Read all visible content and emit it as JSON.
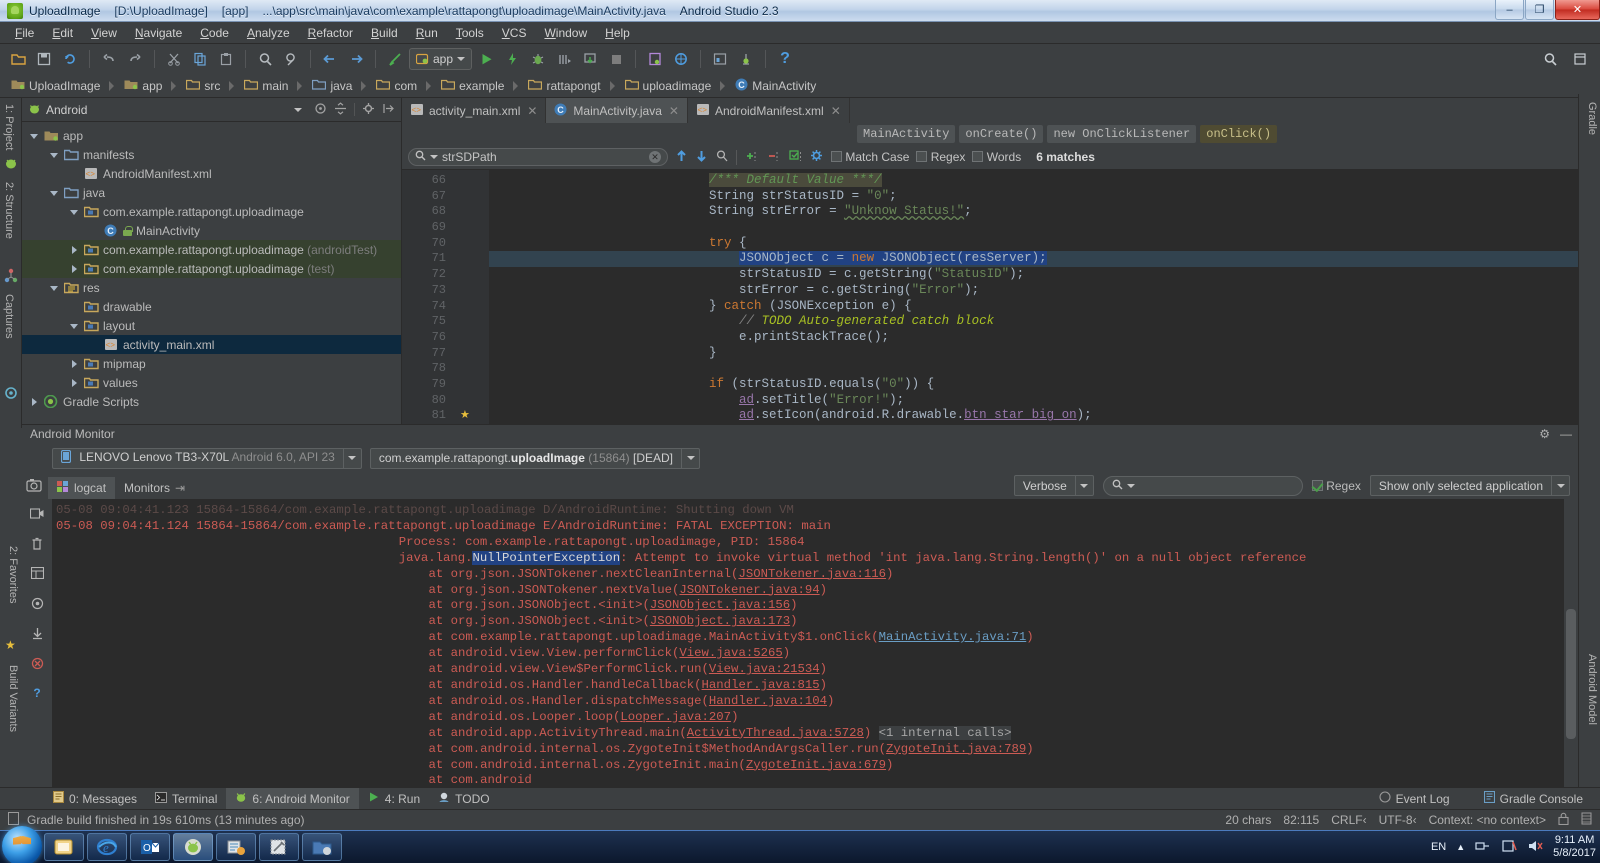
{
  "window": {
    "project_name": "UploadImage",
    "project_path": "[D:\\UploadImage]",
    "module": "[app]",
    "file_path": "...\\app\\src\\main\\java\\com\\example\\rattapongt\\uploadimage\\MainActivity.java",
    "ide": "Android Studio 2.3",
    "minimize": "–",
    "maximize": "❐",
    "close": "✕"
  },
  "menu": [
    "File",
    "Edit",
    "View",
    "Navigate",
    "Code",
    "Analyze",
    "Refactor",
    "Build",
    "Run",
    "Tools",
    "VCS",
    "Window",
    "Help"
  ],
  "toolbar": {
    "run_config": "app",
    "icons": [
      "open-folder-icon",
      "save-all-icon",
      "sync-icon",
      "undo-icon",
      "redo-icon",
      "cut-icon",
      "copy-icon",
      "paste-icon",
      "find-icon",
      "replace-icon",
      "back-icon",
      "forward-icon",
      "build-icon",
      "run-icon",
      "apply-changes-icon",
      "debug-icon",
      "run-coverage-icon",
      "attach-debugger-icon",
      "stop-icon",
      "sdk-manager-icon",
      "avd-manager-icon",
      "layout-inspector-icon",
      "device-monitor-icon",
      "help-icon"
    ],
    "right_icons": [
      "search-everywhere-icon",
      "stretch-icon"
    ]
  },
  "breadcrumb": [
    "UploadImage",
    "app",
    "src",
    "main",
    "java",
    "com",
    "example",
    "rattapongt",
    "uploadimage",
    "MainActivity"
  ],
  "project_panel": {
    "selector": "Android",
    "actions": [
      "target-icon",
      "collapse-icon",
      "settings-icon",
      "hide-icon"
    ],
    "tree": [
      {
        "depth": 0,
        "arrow": "down",
        "icon": "folder-module",
        "label": "app",
        "sel": false
      },
      {
        "depth": 1,
        "arrow": "down",
        "icon": "folder",
        "label": "manifests",
        "sel": false
      },
      {
        "depth": 2,
        "arrow": "none",
        "icon": "xml",
        "label": "AndroidManifest.xml",
        "sel": false
      },
      {
        "depth": 1,
        "arrow": "down",
        "icon": "folder",
        "label": "java",
        "sel": false
      },
      {
        "depth": 2,
        "arrow": "down",
        "icon": "folder-pkg",
        "label": "com.example.rattapongt.uploadimage",
        "sel": false
      },
      {
        "depth": 3,
        "arrow": "none",
        "icon": "class",
        "label": "MainActivity",
        "sel": false
      },
      {
        "depth": 2,
        "arrow": "right",
        "icon": "folder-pkg",
        "label": "com.example.rattapongt.uploadimage",
        "suffix": "(androidTest)",
        "test": true
      },
      {
        "depth": 2,
        "arrow": "right",
        "icon": "folder-pkg",
        "label": "com.example.rattapongt.uploadimage",
        "suffix": "(test)",
        "test": true
      },
      {
        "depth": 1,
        "arrow": "down",
        "icon": "folder-res",
        "label": "res",
        "sel": false
      },
      {
        "depth": 2,
        "arrow": "none",
        "icon": "folder-pkg",
        "label": "drawable",
        "sel": false
      },
      {
        "depth": 2,
        "arrow": "down",
        "icon": "folder-pkg",
        "label": "layout",
        "sel": false
      },
      {
        "depth": 3,
        "arrow": "none",
        "icon": "xml",
        "label": "activity_main.xml",
        "sel": true
      },
      {
        "depth": 2,
        "arrow": "right",
        "icon": "folder-pkg",
        "label": "mipmap",
        "sel": false
      },
      {
        "depth": 2,
        "arrow": "right",
        "icon": "folder-pkg",
        "label": "values",
        "sel": false
      },
      {
        "depth": 0,
        "arrow": "right",
        "icon": "gradle",
        "label": "Gradle Scripts",
        "sel": false
      }
    ]
  },
  "left_rail": [
    "1: Project",
    "2: Structure",
    "Captures"
  ],
  "right_rail": [
    "Gradle",
    "Android Model"
  ],
  "bottom_left_rail": [
    "2: Favorites",
    "Build Variants"
  ],
  "editor": {
    "tabs": [
      {
        "label": "activity_main.xml",
        "icon": "xml-icon",
        "active": false
      },
      {
        "label": "MainActivity.java",
        "icon": "class-icon",
        "active": true
      },
      {
        "label": "AndroidManifest.xml",
        "icon": "xml-icon",
        "active": false
      }
    ],
    "structure_crumbs": [
      {
        "label": "MainActivity",
        "hi": false
      },
      {
        "label": "onCreate()",
        "hi": false
      },
      {
        "label": "new OnClickListener",
        "hi": false
      },
      {
        "label": "onClick()",
        "hi": true
      }
    ],
    "find": {
      "query": "strSDPath",
      "match_case": "Match Case",
      "regex": "Regex",
      "words": "Words",
      "results": "6 matches",
      "close": "✕"
    },
    "first_line_number": 66,
    "lines": [
      {
        "n": 66,
        "html": "            <span class='cm' style='background:#4b4b3c'>/*** Default Value ***/</span>"
      },
      {
        "n": 67,
        "html": "            <span class='id'>String strStatusID</span> <span class='id'>=</span> <span class='str'>\"0\"</span><span class='id'>;</span>"
      },
      {
        "n": 68,
        "html": "            <span class='id'>String strError</span> <span class='id'>=</span> <span class='str wavy'>\"Unknow Status!\"</span><span class='id'>;</span>"
      },
      {
        "n": 69,
        "html": ""
      },
      {
        "n": 70,
        "html": "            <span class='kw'>try</span> <span class='id'>{</span>"
      },
      {
        "n": 71,
        "hl": true,
        "html": "                <span class='sel-hl'><span class='id'>JSONObject c = </span><span class='kw'>new</span><span class='id'> JSONObject(resServer);</span></span>"
      },
      {
        "n": 72,
        "html": "                <span class='id'>strStatusID = c.getString(</span><span class='str'>\"StatusID\"</span><span class='id'>);</span>"
      },
      {
        "n": 73,
        "html": "                <span class='id'>strError = c.getString(</span><span class='str'>\"Error\"</span><span class='id'>);</span>"
      },
      {
        "n": 74,
        "html": "            <span class='id'>}</span> <span class='kw'>catch</span> <span class='id'>(JSONException e) {</span>"
      },
      {
        "n": 75,
        "html": "                <span class='cm2'>// </span><span class='todo'>TODO Auto-generated catch block</span>"
      },
      {
        "n": 76,
        "html": "                <span class='id'>e.printStackTrace();</span>"
      },
      {
        "n": 77,
        "html": "            <span class='id'>}</span>"
      },
      {
        "n": 78,
        "html": ""
      },
      {
        "n": 79,
        "html": "            <span class='kw'>if</span> <span class='id'>(strStatusID.equals(</span><span class='str'>\"0\"</span><span class='id'>)) {</span>"
      },
      {
        "n": 80,
        "html": "                <span class='fieldref'>ad</span><span class='id'>.setTitle(</span><span class='str'>\"Error!\"</span><span class='id'>);</span>"
      },
      {
        "n": 81,
        "html": "                <span class='fieldref'>ad</span><span class='id'>.setIcon(android.R.drawable.</span><span class='fieldref'>btn_star_big_on</span><span class='id'>);</span>"
      }
    ]
  },
  "monitor": {
    "title": "Android Monitor",
    "device": {
      "name": "LENOVO Lenovo TB3-X70L",
      "detail": "Android 6.0, API 23"
    },
    "process": {
      "package_prefix": "com.example.rattapongt.",
      "package_bold": "uploadImage",
      "pid": "(15864)",
      "state": "[DEAD]"
    },
    "tabs": [
      {
        "label": "logcat",
        "active": true
      },
      {
        "label": "Monitors",
        "active": false
      }
    ],
    "log_level": "Verbose",
    "search_placeholder": "",
    "regex_label": "Regex",
    "scope": "Show only selected application",
    "rail_icons": [
      "camera-icon",
      "video-icon",
      "screenshot-icon",
      "layout-icon",
      "gc-icon",
      "dump-icon",
      "down-icon",
      "terminate-icon",
      "clear-icon",
      "scroll-end-icon",
      "up-icon",
      "down2-icon",
      "settings-icon",
      "help-icon"
    ],
    "log_lines": [
      {
        "cls": "dim",
        "text": "05-08 09:04:41.123 15864-15864/com.example.rattapongt.uploadimage D/AndroidRuntime: Shutting down VM"
      },
      {
        "html": "05-08 09:04:41.124 15864-15864/com.example.rattapongt.uploadimage E/AndroidRuntime: FATAL EXCEPTION: main"
      },
      {
        "indent": 46,
        "html": "Process: com.example.rattapongt.uploadimage, PID: 15864"
      },
      {
        "indent": 46,
        "html": "java.lang.<span class='selword'>NullPointerException</span>: Attempt to invoke virtual method 'int java.lang.String.length()' on a null object reference"
      },
      {
        "indent": 50,
        "html": "at org.json.JSONTokener.nextCleanInternal(<span class='lnk'>JSONTokener.java:116</span>)"
      },
      {
        "indent": 50,
        "html": "at org.json.JSONTokener.nextValue(<span class='lnk'>JSONTokener.java:94</span>)"
      },
      {
        "indent": 50,
        "html": "at org.json.JSONObject.&lt;init&gt;(<span class='lnk'>JSONObject.java:156</span>)"
      },
      {
        "indent": 50,
        "html": "at org.json.JSONObject.&lt;init&gt;(<span class='lnk'>JSONObject.java:173</span>)"
      },
      {
        "indent": 50,
        "html": "at com.example.rattapongt.uploadimage.MainActivity$1.onClick(<span class='lnkb'>MainActivity.java:71</span>)"
      },
      {
        "indent": 50,
        "html": "at android.view.View.performClick(<span class='lnk'>View.java:5265</span>)"
      },
      {
        "indent": 50,
        "html": "at android.view.View$PerformClick.run(<span class='lnk'>View.java:21534</span>)"
      },
      {
        "indent": 50,
        "html": "at android.os.Handler.handleCallback(<span class='lnk'>Handler.java:815</span>)"
      },
      {
        "indent": 50,
        "html": "at android.os.Handler.dispatchMessage(<span class='lnk'>Handler.java:104</span>)"
      },
      {
        "indent": 50,
        "html": "at android.os.Looper.loop(<span class='lnk'>Looper.java:207</span>)"
      },
      {
        "indent": 50,
        "html": "at android.app.ActivityThread.main(<span class='lnk'>ActivityThread.java:5728</span>) <span class='internal'>&lt;1 internal calls&gt;</span>"
      },
      {
        "indent": 50,
        "html": "at com.android.internal.os.ZygoteInit$MethodAndArgsCaller.run(<span class='lnk'>ZygoteInit.java:789</span>)"
      },
      {
        "indent": 50,
        "html": "at com.android.internal.os.ZygoteInit.main(<span class='lnk'>ZygoteInit.java:679</span>)"
      },
      {
        "indent": 50,
        "html": "at com.android"
      }
    ]
  },
  "tool_windows": [
    {
      "label": "0: Messages",
      "icon": "messages-icon",
      "active": false
    },
    {
      "label": "Terminal",
      "icon": "terminal-icon",
      "active": false
    },
    {
      "label": "6: Android Monitor",
      "icon": "android-icon",
      "active": true
    },
    {
      "label": "4: Run",
      "icon": "run-icon",
      "active": false
    },
    {
      "label": "TODO",
      "icon": "todo-icon",
      "active": false
    }
  ],
  "tool_windows_right": [
    {
      "label": "Event Log",
      "icon": "event-log-icon"
    },
    {
      "label": "Gradle Console",
      "icon": "gradle-console-icon"
    }
  ],
  "status_bar": {
    "message": "Gradle build finished in 19s 610ms (13 minutes ago)",
    "chars": "20 chars",
    "caret": "82:115",
    "line_sep": "CRLF‹",
    "encoding": "UTF-8‹",
    "context": "Context: <no context>"
  },
  "taskbar": {
    "buttons": [
      "windows-explorer-icon",
      "internet-explorer-icon",
      "outlook-icon",
      "android-studio-icon",
      "sql-icon",
      "tools-icon",
      "folder-icon"
    ],
    "language": "EN",
    "time": "9:11 AM",
    "date": "5/8/2017",
    "tray_icons": [
      "show-hidden-icon",
      "network-icon",
      "flash-icon",
      "volume-icon"
    ]
  },
  "colors": {
    "ide_bg": "#3c3f41",
    "editor_bg": "#2b2b2b",
    "accent_blue": "#214283",
    "error_red": "#cc5b54",
    "keyword_orange": "#cc7832",
    "string_green": "#6a8759"
  }
}
